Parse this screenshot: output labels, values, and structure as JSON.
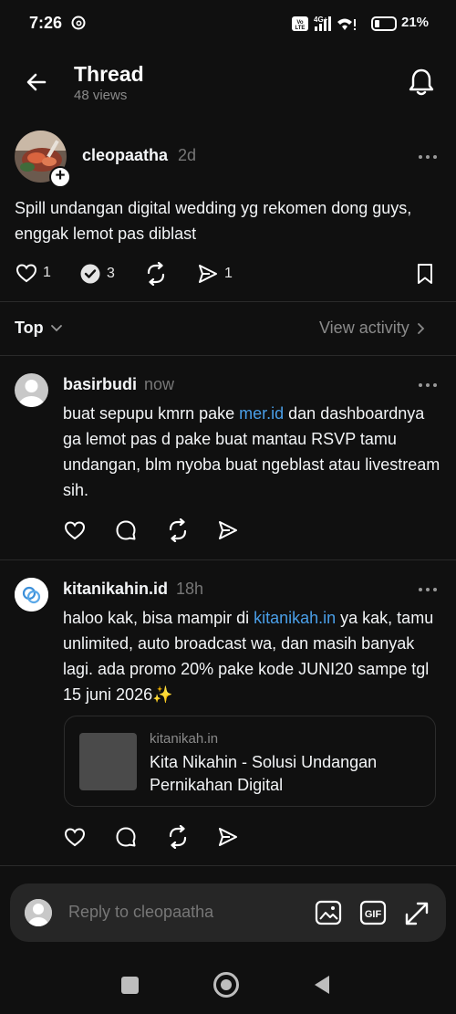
{
  "status_bar": {
    "time": "7:26",
    "battery": "21%"
  },
  "header": {
    "title": "Thread",
    "views": "48 views"
  },
  "post": {
    "username": "cleopaatha",
    "time": "2d",
    "text": "Spill undangan digital wedding yg rekomen dong guys, enggak lemot pas diblast",
    "likes": "1",
    "replies": "3",
    "shares": "1"
  },
  "sort": {
    "label": "Top",
    "view_activity": "View activity"
  },
  "comments": [
    {
      "username": "basirbudi",
      "time": "now",
      "text_before": "buat sepupu kmrn pake ",
      "link": "mer.id",
      "text_after": "  dan dashboardnya ga lemot pas d pake buat mantau RSVP tamu undangan, blm nyoba buat ngeblast atau livestream sih."
    },
    {
      "username": "kitanikahin.id",
      "time": "18h",
      "text_before": "haloo kak, bisa mampir di ",
      "link": "kitanikah.in",
      "text_after": " ya kak, tamu unlimited, auto broadcast wa, dan masih banyak lagi. ada promo 20% pake kode JUNI20 sampe tgl 15 juni 2026✨",
      "card": {
        "domain": "kitanikah.in",
        "title": "Kita Nikahin - Solusi Undangan Pernikahan Digital"
      }
    }
  ],
  "reply_bar": {
    "placeholder": "Reply to cleopaatha"
  },
  "icons": {
    "back": "arrow-left-icon",
    "bell": "bell-icon",
    "like": "heart-icon",
    "reply": "chat-bubble-icon",
    "repost": "repost-icon",
    "share": "send-icon",
    "save": "bookmark-icon",
    "image": "image-icon",
    "gif": "gif-icon",
    "expand": "expand-icon"
  },
  "colors": {
    "background": "#101010",
    "link": "#4a9fe8",
    "muted": "#777777"
  }
}
